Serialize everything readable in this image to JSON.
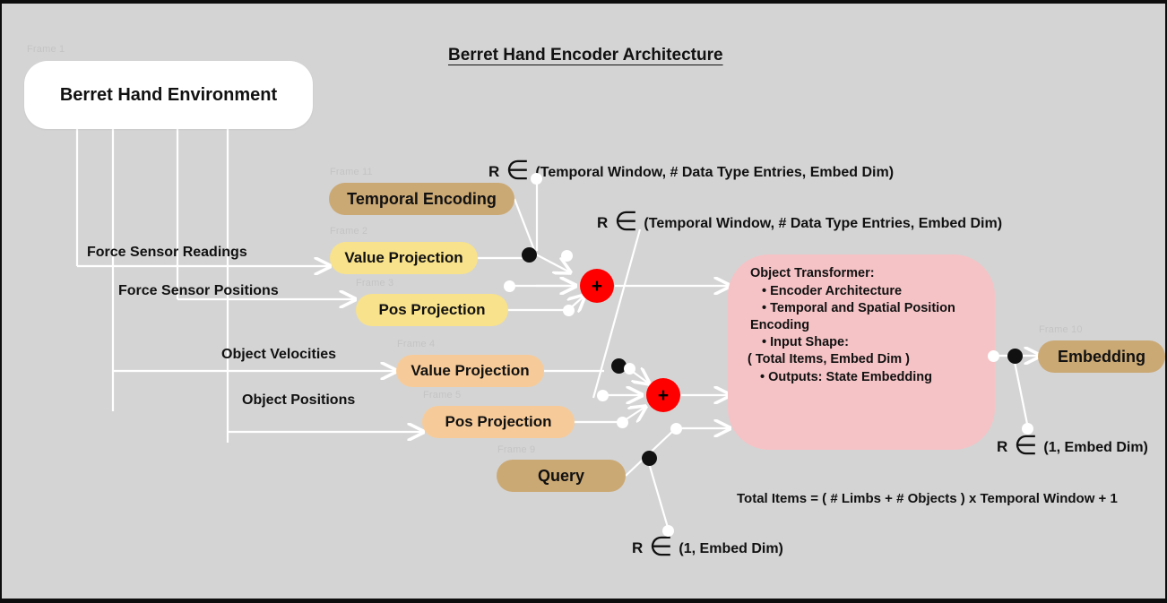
{
  "diagram": {
    "title": "Berret Hand Encoder Architecture",
    "background_color": "#d4d4d4",
    "page_border_color": "#0d0d0d"
  },
  "environment": {
    "frame": "Frame 1",
    "label": "Berret Hand Environment",
    "color": "#ffffff"
  },
  "inputs": [
    {
      "label": "Force Sensor Readings"
    },
    {
      "label": "Force Sensor Positions"
    },
    {
      "label": "Object Velocities"
    },
    {
      "label": "Object Positions"
    }
  ],
  "nodes": [
    {
      "frame": "Frame 11",
      "label": "Temporal Encoding",
      "color": "#cba974"
    },
    {
      "frame": "Frame 2",
      "label": "Value Projection",
      "color": "#f8e28c"
    },
    {
      "frame": "Frame 3",
      "label": "Pos Projection",
      "color": "#f8e28c"
    },
    {
      "frame": "Frame 4",
      "label": "Value Projection",
      "color": "#f7cb99"
    },
    {
      "frame": "Frame 5",
      "label": "Pos Projection",
      "color": "#f7cb99"
    },
    {
      "frame": "Frame 9",
      "label": "Query",
      "color": "#cba974"
    },
    {
      "frame": "Frame 10",
      "label": "Embedding",
      "color": "#cba974"
    }
  ],
  "adders": [
    {
      "symbol": "+",
      "color": "#ff0000"
    },
    {
      "symbol": "+",
      "color": "#ff0000"
    }
  ],
  "transformer": {
    "color": "#f5c3c6",
    "heading": "Object Transformer:",
    "lines": [
      "• Encoder Architecture",
      "• Temporal and Spatial Position",
      "Encoding",
      "• Input Shape:",
      "(  Total Items, Embed Dim )",
      "• Outputs: State Embedding"
    ]
  },
  "annotations": {
    "r_symbol": "R",
    "element_of": "∈",
    "shape_top": "(Temporal Window, # Data Type Entries,  Embed Dim)",
    "shape_mid": "(Temporal Window, # Data Type Entries,  Embed Dim)",
    "shape_query": "(1, Embed Dim)",
    "shape_embedding": "(1, Embed Dim)",
    "total_items_formula": "Total Items = ( # Limbs + # Objects ) x Temporal Window + 1"
  }
}
